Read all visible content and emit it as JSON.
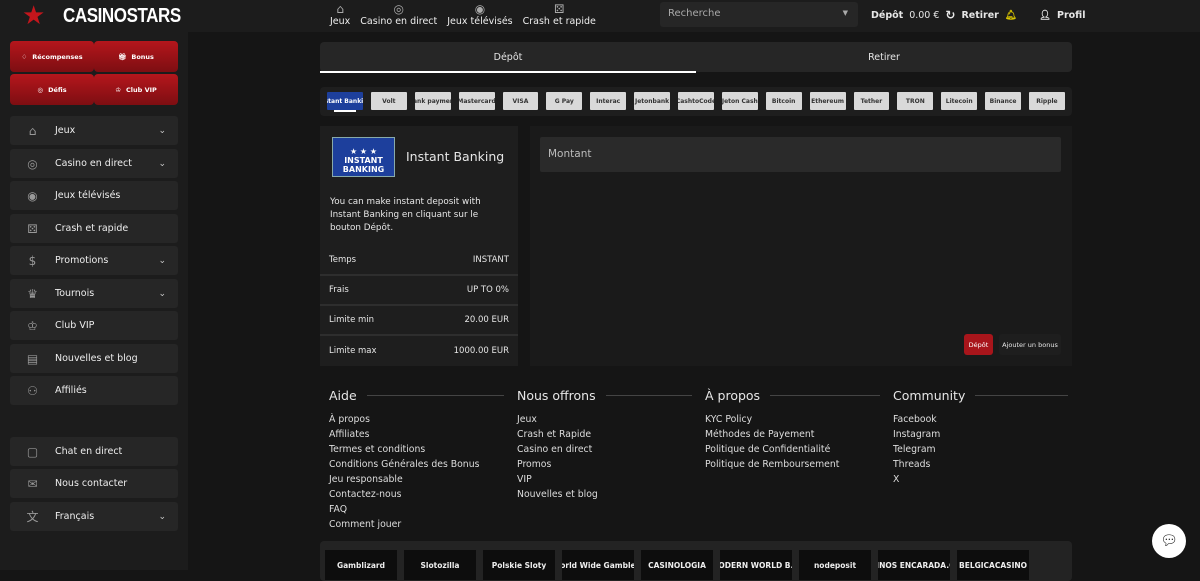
{
  "brand": {
    "name": "CASINOSTARS"
  },
  "nav": [
    {
      "label": "Jeux",
      "icon": "basket-icon"
    },
    {
      "label": "Casino en direct",
      "icon": "roulette-icon"
    },
    {
      "label": "Jeux télévisés",
      "icon": "tv-game-icon"
    },
    {
      "label": "Crash et rapide",
      "icon": "dice-icon"
    }
  ],
  "search": {
    "placeholder": "Recherche"
  },
  "account": {
    "deposit": "Dépôt",
    "balance": "0.00 €",
    "withdraw": "Retirer",
    "profile": "Profil"
  },
  "promo_buttons": [
    {
      "label": "Récompenses"
    },
    {
      "label": "Bonus"
    },
    {
      "label": "Défis"
    },
    {
      "label": "Club VIP"
    }
  ],
  "sidebar": {
    "items": [
      {
        "label": "Jeux",
        "chevron": true
      },
      {
        "label": "Casino en direct",
        "chevron": true
      },
      {
        "label": "Jeux télévisés"
      },
      {
        "label": "Crash et rapide"
      },
      {
        "label": "Promotions",
        "chevron": true
      },
      {
        "label": "Tournois",
        "chevron": true
      },
      {
        "label": "Club VIP"
      },
      {
        "label": "Nouvelles et blog"
      },
      {
        "label": "Affiliés"
      }
    ],
    "bottom": [
      {
        "label": "Chat en direct"
      },
      {
        "label": "Nous contacter"
      },
      {
        "label": "Français",
        "chevron": true
      }
    ]
  },
  "tabs": [
    {
      "label": "Dépôt",
      "active": true
    },
    {
      "label": "Retirer"
    }
  ],
  "payment_methods": [
    "Instant Banking",
    "Volt",
    "Bank payment",
    "Mastercard",
    "VISA",
    "G Pay",
    "Interac",
    "Jetonbank",
    "CashtoCode",
    "Jeton Cash",
    "Bitcoin",
    "Ethereum",
    "Tether",
    "TRON",
    "Litecoin",
    "Binance",
    "Ripple"
  ],
  "method": {
    "title": "Instant Banking",
    "logo_text": "INSTANT BANKING",
    "description": "You can make instant deposit with Instant Banking en cliquant sur le bouton Dépôt.",
    "rows": [
      {
        "label": "Temps",
        "value": "INSTANT"
      },
      {
        "label": "Frais",
        "value": "UP TO 0%"
      },
      {
        "label": "Limite min",
        "value": "20.00 EUR"
      },
      {
        "label": "Limite max",
        "value": "1000.00 EUR"
      }
    ]
  },
  "form": {
    "amount_placeholder": "Montant",
    "deposit_button": "Dépôt",
    "bonus_button": "Ajouter un bonus"
  },
  "footer": [
    {
      "title": "Aide",
      "links": [
        "À propos",
        "Affiliates",
        "Termes et conditions",
        "Conditions Générales des Bonus",
        "Jeu responsable",
        "Contactez-nous",
        "FAQ",
        "Comment jouer"
      ]
    },
    {
      "title": "Nous offrons",
      "links": [
        "Jeux",
        "Crash et Rapide",
        "Casino en direct",
        "Promos",
        "VIP",
        "Nouvelles et blog"
      ]
    },
    {
      "title": "À propos",
      "links": [
        "KYC Policy",
        "Méthodes de Payement",
        "Politique de Confidentialité",
        "Politique de Remboursement"
      ]
    },
    {
      "title": "Community",
      "links": [
        "Facebook",
        "Instagram",
        "Telegram",
        "Threads",
        "X"
      ]
    }
  ],
  "partners": [
    "Gamblizard",
    "Slotozilla",
    "Polskie Sloty",
    "World Wide Gamblers",
    "CASINOLOGIA",
    "MODERN WORLD B.V.",
    "nodeposit",
    "CASINOS ENCARADA.COM",
    "BELGICACASINO"
  ],
  "colors": {
    "accent": "#a8151b",
    "background": "#151515",
    "panel": "#262626",
    "bell": "#d8c400"
  }
}
